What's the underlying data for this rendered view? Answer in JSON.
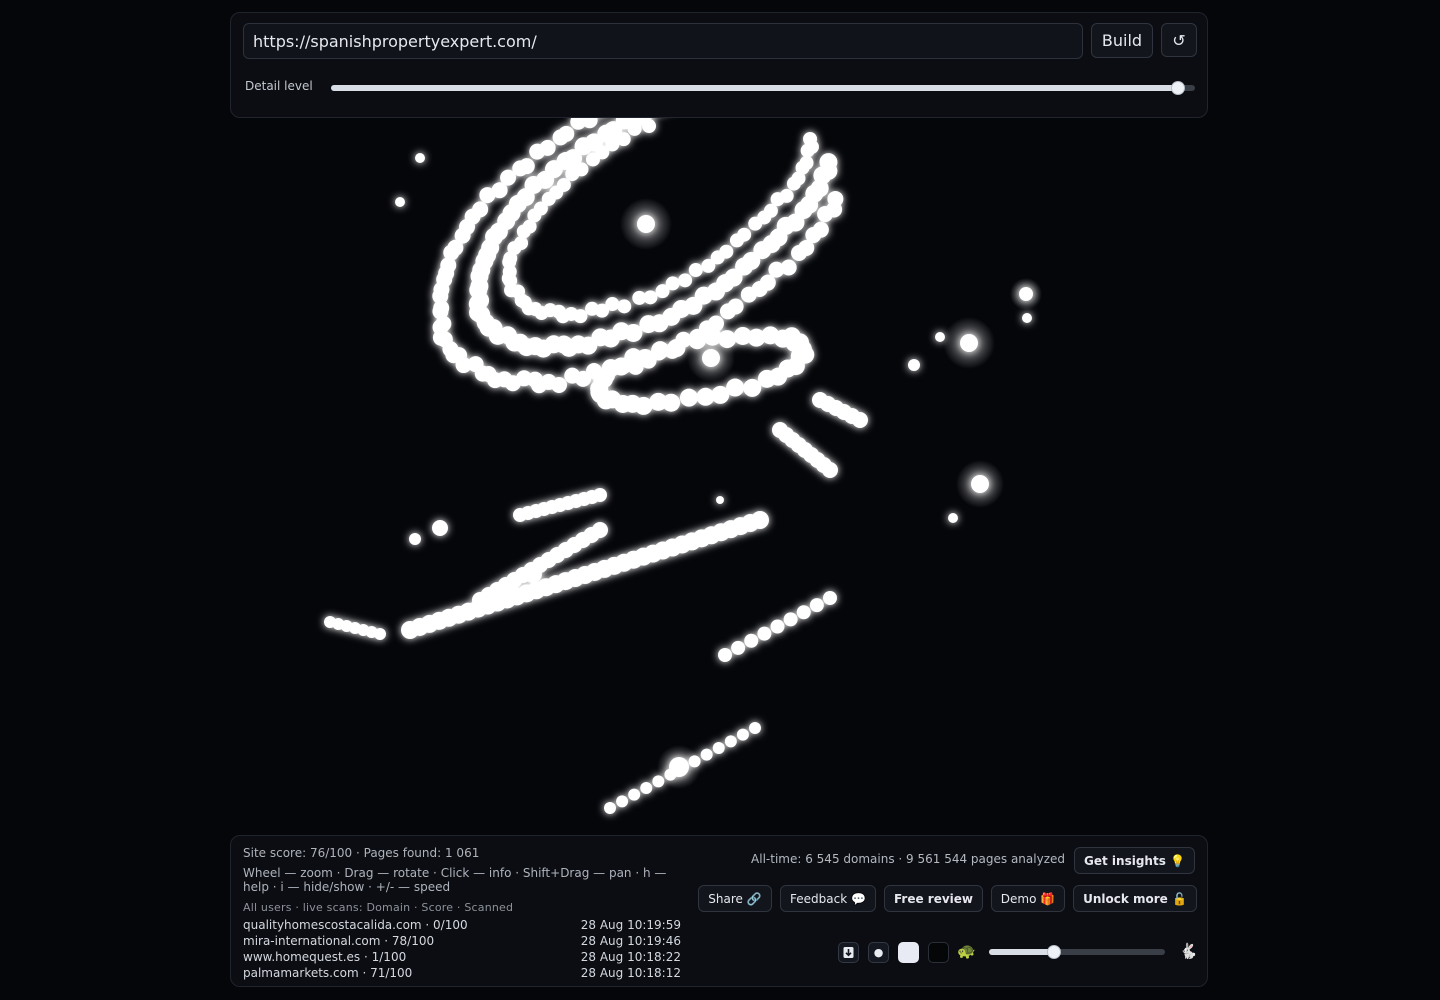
{
  "controls": {
    "url_value": "https://spanishpropertyexpert.com/",
    "build_label": "Build",
    "reset_label": "↺",
    "detail_label": "Detail level",
    "detail_level": 0.98
  },
  "status": {
    "stats": "Site score: 76/100 · Pages found: 1 061",
    "help": "Wheel — zoom · Drag — rotate · Click — info · Shift+Drag — pan · h — help · i — hide/show · +/- — speed",
    "list_header": "All users · live scans: Domain · Score · Scanned",
    "scans": [
      {
        "domain": "qualityhomescostacalida.com · 0/100",
        "time": "28 Aug 10:19:59"
      },
      {
        "domain": "mira-international.com · 78/100",
        "time": "28 Aug 10:19:46"
      },
      {
        "domain": "www.homequest.es · 1/100",
        "time": "28 Aug 10:18:22"
      },
      {
        "domain": "palmamarkets.com · 71/100",
        "time": "28 Aug 10:18:12"
      }
    ],
    "alltime": "All-time: 6 545 domains · 9 561 544 pages analyzed"
  },
  "actions": {
    "insights_label": "Get insights 💡",
    "share_label": "Share 🔗",
    "feedback_label": "Feedback 💬",
    "review_label": "Free review",
    "demo_label": "Demo 🎁",
    "unlock_label": "Unlock more 🔓"
  },
  "toolbar": {
    "download_icon": "download-icon",
    "dot_glyph": "●",
    "turtle_glyph": "🐢",
    "rabbit_glyph": "🐇",
    "speed_level": 0.37
  },
  "colors": {
    "background": "#05060a",
    "glow": "#ffffff"
  }
}
